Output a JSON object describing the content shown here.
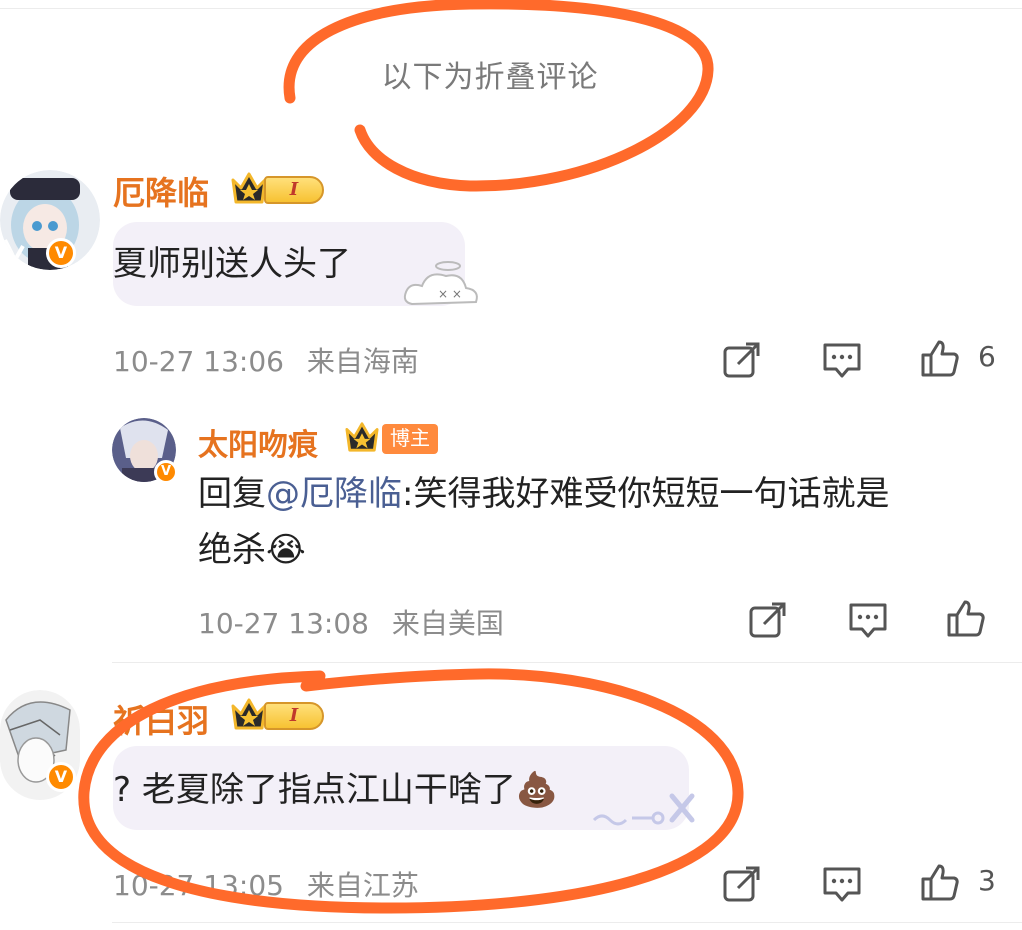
{
  "folded_label": "以下为折叠评论",
  "comments": [
    {
      "username": "厄降临",
      "level_badge": "I",
      "text": "夏师别送人头了",
      "time": "10-27 13:06",
      "location": "来自海南",
      "likes": "6"
    },
    {
      "username": "太阳吻痕",
      "role_badge": "博主",
      "reply_prefix": "回复",
      "mention": "@厄降临",
      "text_line1": ":笑得我好难受你短短一句话就是",
      "text_line2": "绝杀",
      "emoji": "😭",
      "time": "10-27 13:08",
      "location": "来自美国",
      "likes": ""
    },
    {
      "username": "祈白羽",
      "level_badge": "I",
      "text": "? 老夏除了指点江山干啥了",
      "emoji": "💩",
      "time": "10-27 13:05",
      "location": "来自江苏",
      "likes": "3"
    }
  ],
  "icons": {
    "share": "share-icon",
    "comment": "comment-icon",
    "like": "thumbs-up-icon",
    "verified": "verified-icon",
    "crown": "crown-icon"
  },
  "colors": {
    "username": "#e6731f",
    "annotation": "#ff6a2b",
    "mention": "#4a5f93",
    "meta": "#8c8c8c"
  }
}
